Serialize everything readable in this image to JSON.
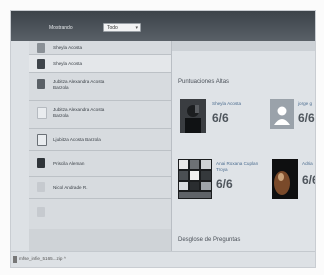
{
  "toolbar": {
    "filter_label": "Mostrando",
    "filter_value": "Todo"
  },
  "sidebar": {
    "items": [
      {
        "label": "Sheyla Acosta"
      },
      {
        "label": "Sheyla Acosta"
      },
      {
        "label": "Jubitza Alexandra Acosta Barzola"
      },
      {
        "label": "Jubitza Alexandra Acosta Barzola"
      },
      {
        "label": "Ljubitza Acosta Barzola"
      },
      {
        "label": "Priscila Aleman"
      },
      {
        "label": "Nicol Andrade R."
      }
    ]
  },
  "main": {
    "scores_title": "Puntuaciones Altas",
    "cards": [
      {
        "name": "Sheyla Acosta",
        "score": "6/6"
      },
      {
        "name": "jorge g",
        "score": "6/6"
      },
      {
        "name": "Anai Roxana Cuplan Troya",
        "score": "6/6"
      },
      {
        "name": "Adria",
        "score": "6/6"
      }
    ],
    "breakdown_title": "Desglose de Preguntas"
  },
  "downloads": {
    "file": "mfse_infie_5165...zip"
  }
}
